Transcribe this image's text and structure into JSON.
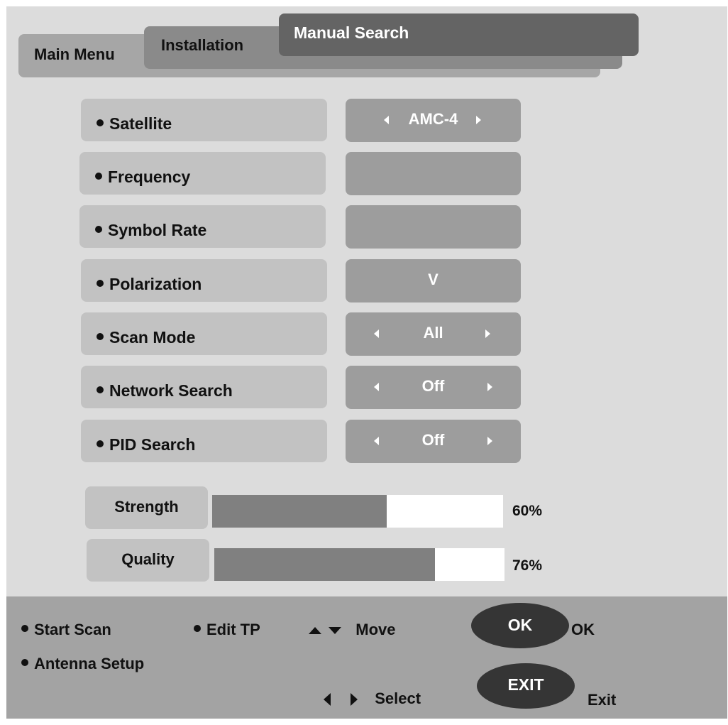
{
  "breadcrumb": {
    "main": "Main Menu",
    "installation": "Installation",
    "current": "Manual Search"
  },
  "settings": [
    {
      "label": "Satellite",
      "value": "AMC-4",
      "arrows": true
    },
    {
      "label": "Frequency",
      "value": "",
      "arrows": false
    },
    {
      "label": "Symbol Rate",
      "value": "",
      "arrows": false
    },
    {
      "label": "Polarization",
      "value": "V",
      "arrows": false
    },
    {
      "label": "Scan Mode",
      "value": "All",
      "arrows": true
    },
    {
      "label": "Network Search",
      "value": "Off",
      "arrows": true
    },
    {
      "label": "PID Search",
      "value": "Off",
      "arrows": true
    }
  ],
  "signal": {
    "strength": {
      "label": "Strength",
      "value": 60,
      "text": "60%"
    },
    "quality": {
      "label": "Quality",
      "value": 76,
      "text": "76%"
    }
  },
  "footer": {
    "start_scan": "Start Scan",
    "edit_tp": "Edit TP",
    "move": "Move",
    "ok_button": "OK",
    "ok_label": "OK",
    "antenna_setup": "Antenna Setup",
    "select": "Select",
    "exit_button": "EXIT",
    "exit_label": "Exit"
  },
  "colors": {
    "screen_bg": "#dcdcdc",
    "label_bg": "#c2c2c2",
    "value_bg": "#9d9d9d",
    "bar_fill": "#808080",
    "footer_bg": "#a3a3a3",
    "oval_bg": "#353535"
  }
}
